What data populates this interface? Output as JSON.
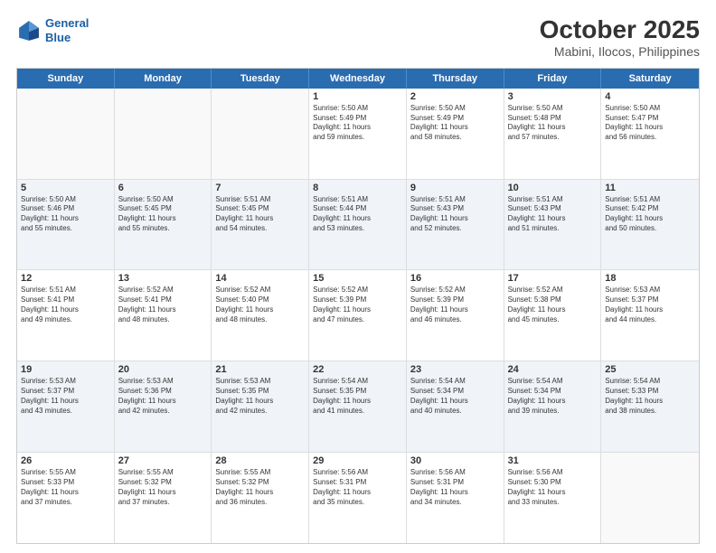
{
  "logo": {
    "line1": "General",
    "line2": "Blue"
  },
  "title": "October 2025",
  "subtitle": "Mabini, Ilocos, Philippines",
  "weekdays": [
    "Sunday",
    "Monday",
    "Tuesday",
    "Wednesday",
    "Thursday",
    "Friday",
    "Saturday"
  ],
  "weeks": [
    [
      {
        "day": "",
        "info": ""
      },
      {
        "day": "",
        "info": ""
      },
      {
        "day": "",
        "info": ""
      },
      {
        "day": "1",
        "info": "Sunrise: 5:50 AM\nSunset: 5:49 PM\nDaylight: 11 hours\nand 59 minutes."
      },
      {
        "day": "2",
        "info": "Sunrise: 5:50 AM\nSunset: 5:49 PM\nDaylight: 11 hours\nand 58 minutes."
      },
      {
        "day": "3",
        "info": "Sunrise: 5:50 AM\nSunset: 5:48 PM\nDaylight: 11 hours\nand 57 minutes."
      },
      {
        "day": "4",
        "info": "Sunrise: 5:50 AM\nSunset: 5:47 PM\nDaylight: 11 hours\nand 56 minutes."
      }
    ],
    [
      {
        "day": "5",
        "info": "Sunrise: 5:50 AM\nSunset: 5:46 PM\nDaylight: 11 hours\nand 55 minutes."
      },
      {
        "day": "6",
        "info": "Sunrise: 5:50 AM\nSunset: 5:45 PM\nDaylight: 11 hours\nand 55 minutes."
      },
      {
        "day": "7",
        "info": "Sunrise: 5:51 AM\nSunset: 5:45 PM\nDaylight: 11 hours\nand 54 minutes."
      },
      {
        "day": "8",
        "info": "Sunrise: 5:51 AM\nSunset: 5:44 PM\nDaylight: 11 hours\nand 53 minutes."
      },
      {
        "day": "9",
        "info": "Sunrise: 5:51 AM\nSunset: 5:43 PM\nDaylight: 11 hours\nand 52 minutes."
      },
      {
        "day": "10",
        "info": "Sunrise: 5:51 AM\nSunset: 5:43 PM\nDaylight: 11 hours\nand 51 minutes."
      },
      {
        "day": "11",
        "info": "Sunrise: 5:51 AM\nSunset: 5:42 PM\nDaylight: 11 hours\nand 50 minutes."
      }
    ],
    [
      {
        "day": "12",
        "info": "Sunrise: 5:51 AM\nSunset: 5:41 PM\nDaylight: 11 hours\nand 49 minutes."
      },
      {
        "day": "13",
        "info": "Sunrise: 5:52 AM\nSunset: 5:41 PM\nDaylight: 11 hours\nand 48 minutes."
      },
      {
        "day": "14",
        "info": "Sunrise: 5:52 AM\nSunset: 5:40 PM\nDaylight: 11 hours\nand 48 minutes."
      },
      {
        "day": "15",
        "info": "Sunrise: 5:52 AM\nSunset: 5:39 PM\nDaylight: 11 hours\nand 47 minutes."
      },
      {
        "day": "16",
        "info": "Sunrise: 5:52 AM\nSunset: 5:39 PM\nDaylight: 11 hours\nand 46 minutes."
      },
      {
        "day": "17",
        "info": "Sunrise: 5:52 AM\nSunset: 5:38 PM\nDaylight: 11 hours\nand 45 minutes."
      },
      {
        "day": "18",
        "info": "Sunrise: 5:53 AM\nSunset: 5:37 PM\nDaylight: 11 hours\nand 44 minutes."
      }
    ],
    [
      {
        "day": "19",
        "info": "Sunrise: 5:53 AM\nSunset: 5:37 PM\nDaylight: 11 hours\nand 43 minutes."
      },
      {
        "day": "20",
        "info": "Sunrise: 5:53 AM\nSunset: 5:36 PM\nDaylight: 11 hours\nand 42 minutes."
      },
      {
        "day": "21",
        "info": "Sunrise: 5:53 AM\nSunset: 5:35 PM\nDaylight: 11 hours\nand 42 minutes."
      },
      {
        "day": "22",
        "info": "Sunrise: 5:54 AM\nSunset: 5:35 PM\nDaylight: 11 hours\nand 41 minutes."
      },
      {
        "day": "23",
        "info": "Sunrise: 5:54 AM\nSunset: 5:34 PM\nDaylight: 11 hours\nand 40 minutes."
      },
      {
        "day": "24",
        "info": "Sunrise: 5:54 AM\nSunset: 5:34 PM\nDaylight: 11 hours\nand 39 minutes."
      },
      {
        "day": "25",
        "info": "Sunrise: 5:54 AM\nSunset: 5:33 PM\nDaylight: 11 hours\nand 38 minutes."
      }
    ],
    [
      {
        "day": "26",
        "info": "Sunrise: 5:55 AM\nSunset: 5:33 PM\nDaylight: 11 hours\nand 37 minutes."
      },
      {
        "day": "27",
        "info": "Sunrise: 5:55 AM\nSunset: 5:32 PM\nDaylight: 11 hours\nand 37 minutes."
      },
      {
        "day": "28",
        "info": "Sunrise: 5:55 AM\nSunset: 5:32 PM\nDaylight: 11 hours\nand 36 minutes."
      },
      {
        "day": "29",
        "info": "Sunrise: 5:56 AM\nSunset: 5:31 PM\nDaylight: 11 hours\nand 35 minutes."
      },
      {
        "day": "30",
        "info": "Sunrise: 5:56 AM\nSunset: 5:31 PM\nDaylight: 11 hours\nand 34 minutes."
      },
      {
        "day": "31",
        "info": "Sunrise: 5:56 AM\nSunset: 5:30 PM\nDaylight: 11 hours\nand 33 minutes."
      },
      {
        "day": "",
        "info": ""
      }
    ]
  ]
}
